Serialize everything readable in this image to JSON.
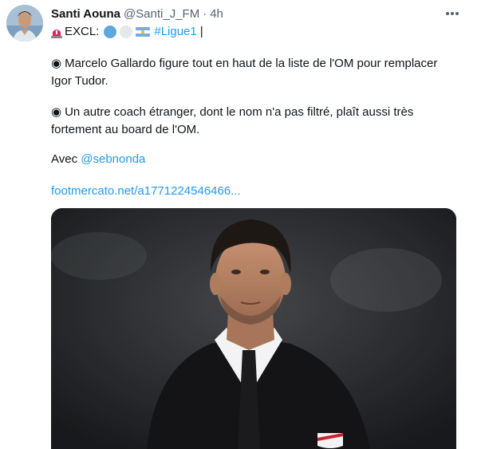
{
  "tweet": {
    "author_name": "Santi Aouna",
    "author_handle": "@Santi_J_FM",
    "separator": "·",
    "time": "4h",
    "line1_text": "EXCL:",
    "hashtag": "#Ligue1",
    "cursor": "|",
    "paragraph1_bullet": "◉",
    "paragraph1": "Marcelo Gallardo figure tout en haut de la liste de l'OM pour remplacer Igor Tudor.",
    "paragraph2_bullet": "◉",
    "paragraph2": "Un autre coach étranger, dont le nom n'a pas filtré, plaît aussi très fortement au board de l'OM.",
    "with_label": "Avec",
    "mention": "@sebnonda",
    "link": "footmercato.net/a1771224546466..."
  },
  "icons": {
    "siren": "rotating-light-icon",
    "circle1": "blue-circle-icon",
    "circle2": "white-circle-icon",
    "flag": "argentina-flag-icon",
    "more": "more-horizontal-icon"
  },
  "colors": {
    "accent": "#1d9bf0",
    "text": "#0f1419",
    "muted": "#536471"
  }
}
